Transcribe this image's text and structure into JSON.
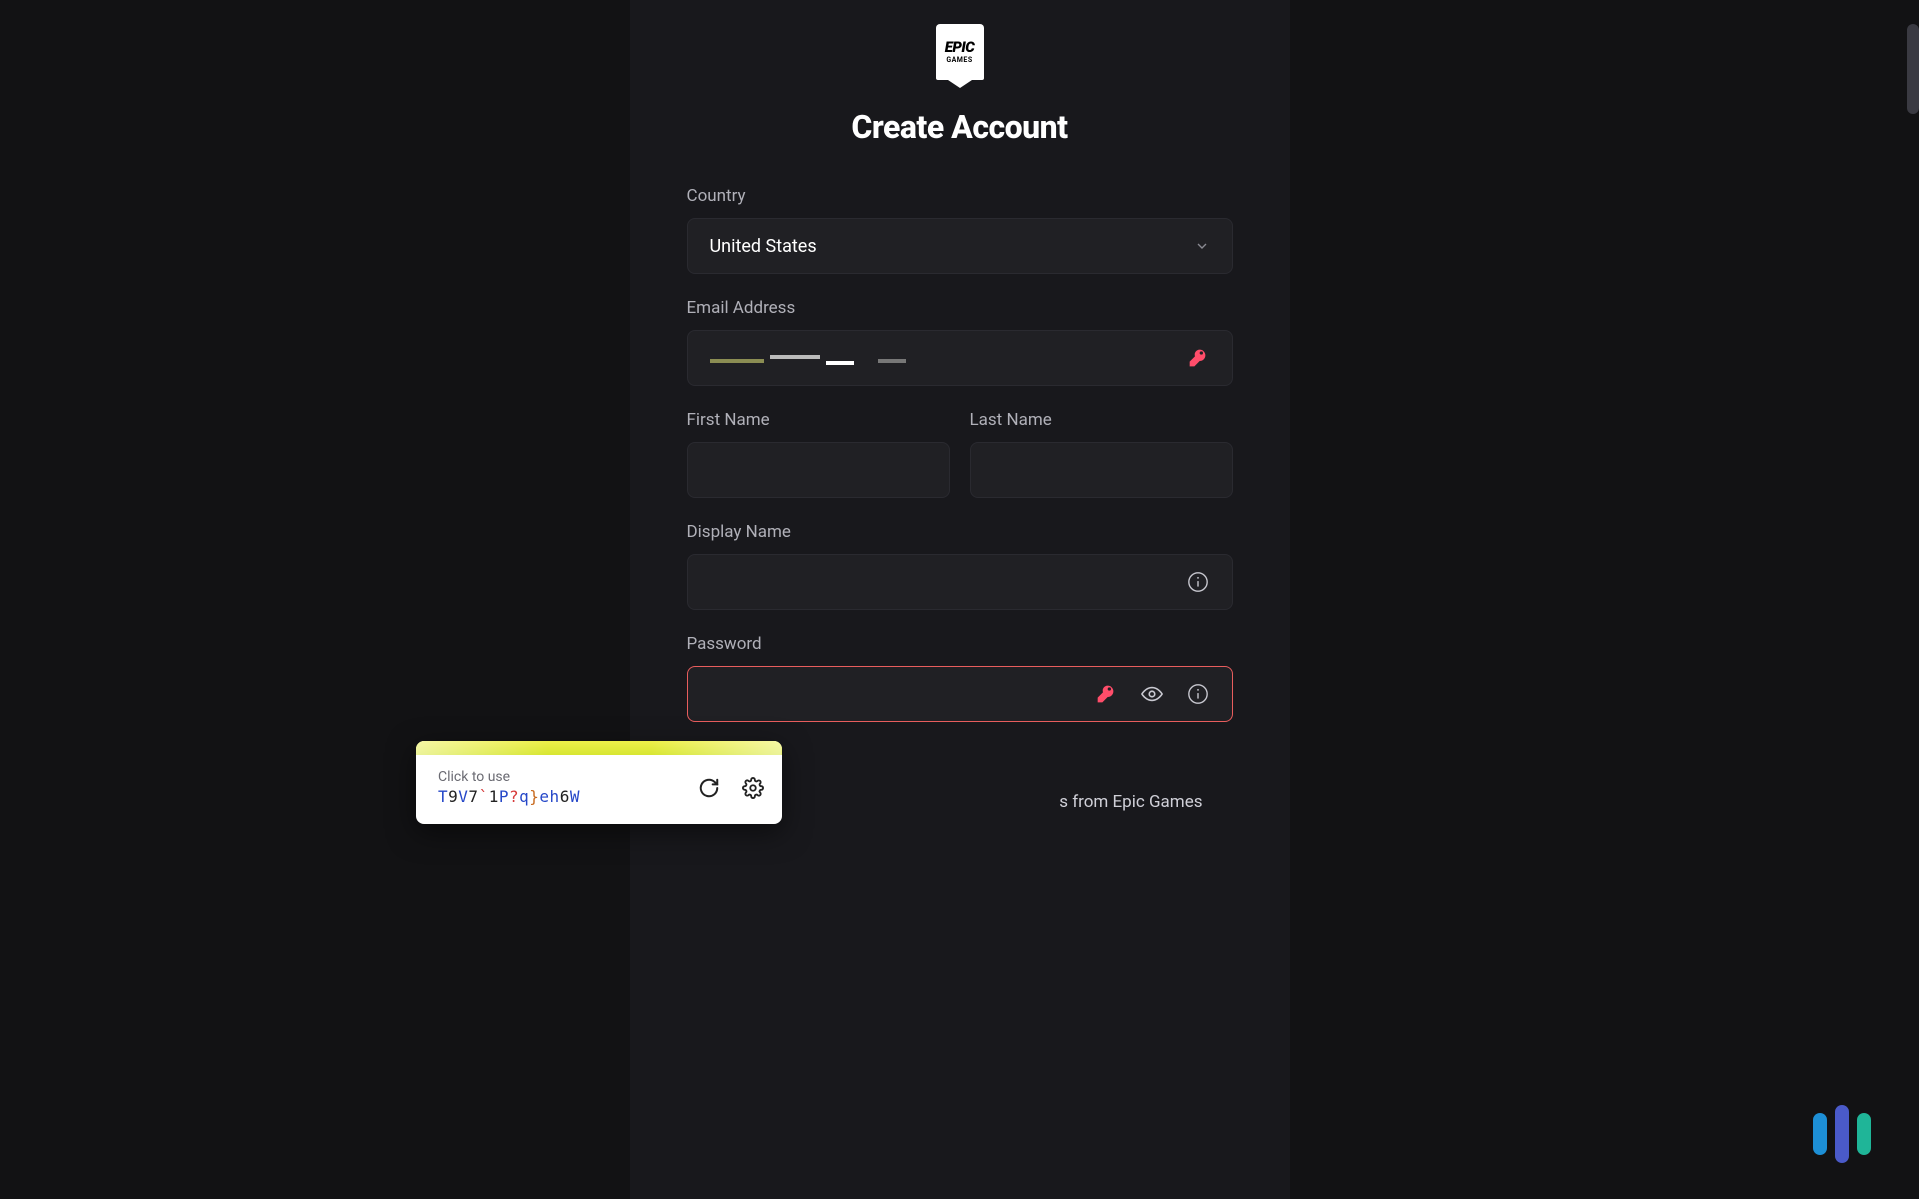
{
  "logo": {
    "top": "EPIC",
    "bottom": "GAMES"
  },
  "title": "Create Account",
  "fields": {
    "country": {
      "label": "Country",
      "value": "United States"
    },
    "email": {
      "label": "Email Address"
    },
    "firstName": {
      "label": "First Name"
    },
    "lastName": {
      "label": "Last Name"
    },
    "displayName": {
      "label": "Display Name"
    },
    "password": {
      "label": "Password"
    }
  },
  "consent": {
    "text_fragment": "s from Epic Games"
  },
  "passwordSuggestion": {
    "hint": "Click to use",
    "segments": [
      {
        "t": "T",
        "c": "blue"
      },
      {
        "t": "9",
        "c": "black"
      },
      {
        "t": "V",
        "c": "blue"
      },
      {
        "t": "7",
        "c": "black"
      },
      {
        "t": "`",
        "c": "red"
      },
      {
        "t": "1",
        "c": "black"
      },
      {
        "t": "P",
        "c": "blue"
      },
      {
        "t": "?",
        "c": "red"
      },
      {
        "t": "q",
        "c": "blue"
      },
      {
        "t": "}",
        "c": "orange"
      },
      {
        "t": "e",
        "c": "blue"
      },
      {
        "t": "h",
        "c": "blue"
      },
      {
        "t": "6",
        "c": "black"
      },
      {
        "t": "W",
        "c": "blue"
      }
    ]
  }
}
